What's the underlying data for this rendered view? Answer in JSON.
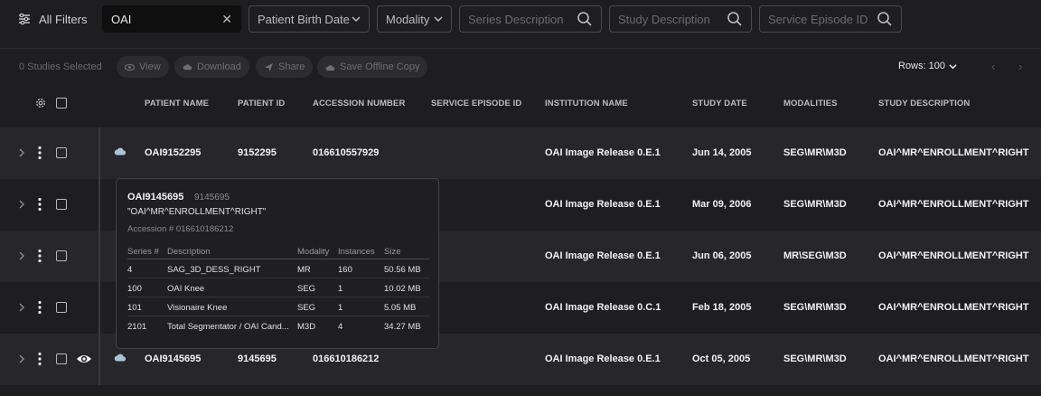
{
  "filters": {
    "all_filters_label": "All Filters",
    "search_value": "OAI",
    "birth_date_label": "Patient Birth Date",
    "modality_label": "Modality",
    "series_desc_placeholder": "Series Description",
    "study_desc_placeholder": "Study Description",
    "service_episode_placeholder": "Service Episode ID"
  },
  "toolbar": {
    "selected_count": "0 Studies Selected",
    "view_label": "View",
    "download_label": "Download",
    "share_label": "Share",
    "save_offline_label": "Save Offline Copy",
    "rows_label": "Rows: 100",
    "prev": "‹",
    "next": "›"
  },
  "columns": {
    "patient_name": "PATIENT NAME",
    "patient_id": "PATIENT ID",
    "accession_number": "ACCESSION NUMBER",
    "service_episode_id": "SERVICE EPISODE ID",
    "institution_name": "INSTITUTION NAME",
    "study_date": "STUDY DATE",
    "modalities": "MODALITIES",
    "study_description": "STUDY DESCRIPTION"
  },
  "rows": [
    {
      "patient_name": "OAI9152295",
      "patient_id": "9152295",
      "accession": "016610557929",
      "institution": "OAI Image Release 0.E.1",
      "study_date": "Jun 14, 2005",
      "modalities": "SEG\\MR\\M3D",
      "description": "OAI^MR^ENROLLMENT^RIGHT"
    },
    {
      "patient_name": "",
      "patient_id": "",
      "accession": "",
      "institution": "OAI Image Release 0.E.1",
      "study_date": "Mar 09, 2006",
      "modalities": "SEG\\MR\\M3D",
      "description": "OAI^MR^ENROLLMENT^RIGHT"
    },
    {
      "patient_name": "",
      "patient_id": "",
      "accession": "",
      "institution": "OAI Image Release 0.E.1",
      "study_date": "Jun 06, 2005",
      "modalities": "MR\\SEG\\M3D",
      "description": "OAI^MR^ENROLLMENT^RIGHT"
    },
    {
      "patient_name": "",
      "patient_id": "",
      "accession": "",
      "institution": "OAI Image Release 0.C.1",
      "study_date": "Feb 18, 2005",
      "modalities": "SEG\\MR\\M3D",
      "description": "OAI^MR^ENROLLMENT^RIGHT"
    },
    {
      "patient_name": "OAI9145695",
      "patient_id": "9145695",
      "accession": "016610186212",
      "institution": "OAI Image Release 0.E.1",
      "study_date": "Oct 05, 2005",
      "modalities": "SEG\\MR\\M3D",
      "description": "OAI^MR^ENROLLMENT^RIGHT"
    }
  ],
  "popover": {
    "patient_name": "OAI9145695",
    "patient_id": "9145695",
    "description": "\"OAI^MR^ENROLLMENT^RIGHT\"",
    "accession": "Accession # 016610186212",
    "headers": {
      "series": "Series #",
      "description": "Description",
      "modality": "Modality",
      "instances": "Instances",
      "size": "Size"
    },
    "series": [
      {
        "series": "4",
        "description": "SAG_3D_DESS_RIGHT",
        "modality": "MR",
        "instances": "160",
        "size": "50.56 MB"
      },
      {
        "series": "100",
        "description": "OAI Knee",
        "modality": "SEG",
        "instances": "1",
        "size": "10.02 MB"
      },
      {
        "series": "101",
        "description": "Visionaire Knee",
        "modality": "SEG",
        "instances": "1",
        "size": "5.05 MB"
      },
      {
        "series": "2101",
        "description": "Total Segmentator / OAI Cand...",
        "modality": "M3D",
        "instances": "4",
        "size": "34.27 MB"
      }
    ]
  },
  "icons": {
    "filter": "sliders-icon",
    "clear": "close-icon",
    "search": "search-icon",
    "expand": "chevron-right-icon",
    "menu": "kebab-icon",
    "cloud": "cloud-icon",
    "eye": "eye-icon",
    "settings": "gear-icon"
  }
}
